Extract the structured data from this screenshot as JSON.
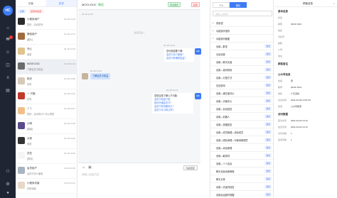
{
  "app": {
    "logo": "HC"
  },
  "rail": [
    {
      "icon": "home-icon",
      "glyph": "⌂",
      "top": 0
    },
    {
      "icon": "chat-icon",
      "glyph": "✉",
      "top": 0
    },
    {
      "icon": "user-icon",
      "glyph": "☺",
      "top": 0
    },
    {
      "icon": "mail-icon",
      "glyph": "✉",
      "top": 0
    },
    {
      "icon": "list-icon",
      "glyph": "≡",
      "top": 0
    },
    {
      "icon": "doc-icon",
      "glyph": "▤",
      "top": 0
    },
    {
      "icon": "team-icon",
      "glyph": "⚇",
      "top": 0
    },
    {
      "icon": "settings-icon",
      "glyph": "⚙",
      "top": 0
    }
  ],
  "list": {
    "tabs": [
      "访客",
      "历史"
    ],
    "subtabs": [
      "全部",
      "接待中会话"
    ],
    "rows": [
      {
        "name": "小程序用户",
        "time": "04-18 14:26",
        "msg": "您好，请问在吗",
        "color": "#2b2b2b"
      },
      {
        "name": "微信用户",
        "time": "04-18 14:21",
        "msg": "[图片]",
        "color": "#a06b3d"
      },
      {
        "name": "开心",
        "time": "04-18 14:15",
        "msg": "谢谢",
        "color": "#e0c48c"
      },
      {
        "name": "MOOI DOC",
        "time": "04-18 14:13",
        "msg": "了解会员卡权益",
        "color": "#6b6b6b"
      },
      {
        "name": "阳光",
        "time": "04-18 14:08",
        "msg": "好的",
        "color": "#d7c9b8"
      },
      {
        "name": "一 只猫",
        "time": "04-18 14:04",
        "msg": "在吗",
        "color": "#c0392b"
      },
      {
        "name": "丫丫",
        "time": "04-18 13:57",
        "msg": "您好，请问有什么可以帮您",
        "color": "#f0c08a"
      },
      {
        "name": "小明",
        "time": "04-18 13:49",
        "msg": "[链接]",
        "color": "#5a4a8a"
      },
      {
        "name": "大熊",
        "time": "04-18 13:40",
        "msg": "收到",
        "color": "#333333"
      },
      {
        "name": "花花",
        "time": "04-18 13:32",
        "msg": "[表情]",
        "color": "#f6f6f6"
      },
      {
        "name": "会员用户",
        "time": "04-18 13:20",
        "msg": "会员卡怎么使用",
        "color": "#a9b4c2"
      },
      {
        "name": "小程序访客",
        "time": "04-18 13:11",
        "msg": "好的谢谢",
        "color": "#e8d8c8"
      }
    ]
  },
  "chat": {
    "title": "MOOI DOC",
    "platform": "微信",
    "btn_transfer": "转出服务",
    "btn_end": "结束",
    "meta_top": "04-18 14:13",
    "sys_msg": "会话已接入",
    "bubble1_meta": "04-18 14:13",
    "bubble1_title": "您可能需要了解：",
    "bubble1_q1": "会员卡怎么使用？",
    "bubble1_q2": "会员卡有哪些权益？",
    "cust_msg": "了解会员卡权益",
    "cust_meta": "04-18 14:13",
    "bubble2_meta": "04-18 14:13",
    "bubble2_title": "您是否想了解以下问题：",
    "bubble2_q1": "会员卡权益介绍",
    "bubble2_q2": "如何开通会员卡？",
    "bubble2_q3": "会员卡有效期多久？",
    "bubble2_q4": "会员卡可以转让吗？",
    "quick_btn": "快捷回复",
    "placeholder": "请输入回复内容"
  },
  "qr": {
    "tabs": [
      "个人",
      "团队"
    ],
    "search_placeholder": "请输入关键字",
    "items": [
      {
        "arrow": "▸",
        "label": "常用语",
        "send": ""
      },
      {
        "arrow": "▸",
        "label": "功能操作指导",
        "send": ""
      },
      {
        "arrow": "▾",
        "label": "功能操作截图",
        "send": ""
      },
      {
        "arrow": "",
        "label": "设置—群发",
        "send": "发送"
      },
      {
        "arrow": "",
        "label": "对话设置",
        "send": "发送"
      },
      {
        "arrow": "",
        "label": "设置—聊天页面",
        "send": "发送"
      },
      {
        "arrow": "",
        "label": "设置—接待规则",
        "send": "发送"
      },
      {
        "arrow": "",
        "label": "设置—分配方式",
        "send": "发送"
      },
      {
        "arrow": "",
        "label": "在线咨询",
        "send": "发送"
      },
      {
        "arrow": "",
        "label": "设置—满意度评价",
        "send": "发送"
      },
      {
        "arrow": "",
        "label": "设置—访客评价",
        "send": "发送"
      },
      {
        "arrow": "",
        "label": "设置—自动回复",
        "send": "发送"
      },
      {
        "arrow": "",
        "label": "设置—机器人",
        "send": "发送"
      },
      {
        "arrow": "",
        "label": "设置—快捷回复",
        "send": "发送"
      },
      {
        "arrow": "",
        "label": "设置—成员管理—添加成员",
        "send": "发送"
      },
      {
        "arrow": "",
        "label": "设置—团队管理—可使用管理员",
        "send": "发送"
      },
      {
        "arrow": "",
        "label": "设置—消息管理",
        "send": "发送"
      },
      {
        "arrow": "",
        "label": "设置—敏感词",
        "send": "发送"
      },
      {
        "arrow": "",
        "label": "设置—个人信息",
        "send": "发送"
      },
      {
        "arrow": "",
        "label": "聊天页面设置教程",
        "send": "发送"
      },
      {
        "arrow": "",
        "label": "聊天记录",
        "send": "发送"
      },
      {
        "arrow": "",
        "label": "设置—关键词回复",
        "send": "发送"
      },
      {
        "arrow": "",
        "label": "设置会话超时提醒",
        "send": "发送"
      }
    ]
  },
  "info": {
    "title": "顾客信息",
    "section_basic": "基本信息",
    "rows_basic": [
      {
        "k": "标签",
        "v": ""
      },
      {
        "k": "昵称",
        "v": "MOOI DOC"
      },
      {
        "k": "姓名",
        "v": ""
      },
      {
        "k": "手机号",
        "v": ""
      },
      {
        "k": "邮箱",
        "v": ""
      },
      {
        "k": "公司",
        "v": ""
      },
      {
        "k": "地址",
        "v": ""
      }
    ],
    "section_note": "顾客备注",
    "section_wx": "公众号信息",
    "rows_wx": [
      {
        "k": "性别",
        "v": "男"
      },
      {
        "k": "昵称",
        "v": "MOOI DOC"
      },
      {
        "k": "地区",
        "v": "广东深圳"
      },
      {
        "k": "关注时间",
        "v": "2021-04-09 14:51:06"
      },
      {
        "k": "来源",
        "v": "公众号搜索"
      }
    ],
    "section_visit": "访问数据",
    "rows_visit": [
      {
        "k": "首次访问",
        "v": "2021-04-18 14:13"
      },
      {
        "k": "最近访问",
        "v": "2021-04-18 14:13"
      },
      {
        "k": "访问次数",
        "v": "1"
      },
      {
        "k": "会话次数",
        "v": "1"
      }
    ]
  }
}
